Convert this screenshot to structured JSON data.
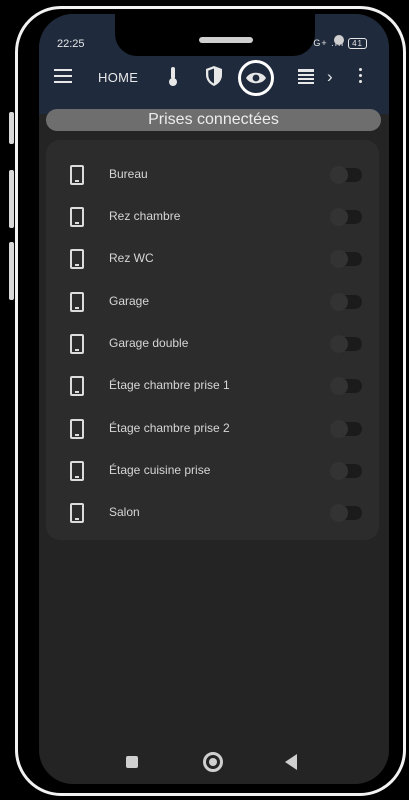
{
  "status": {
    "time": "22:25",
    "right": "4G+ .ıll",
    "battery": "41"
  },
  "appbar": {
    "home_label": "HOME",
    "tabs": [
      "menu-icon",
      "thermometer-icon",
      "shield-icon",
      "eye-icon",
      "list-icon",
      "chevron-right-icon",
      "more-vert-icon"
    ],
    "active_tab": "eye-icon",
    "chevron": "›"
  },
  "section": {
    "title": "Prises connectées"
  },
  "devices": [
    {
      "label": "Bureau",
      "on": false
    },
    {
      "label": "Rez chambre",
      "on": false
    },
    {
      "label": "Rez WC",
      "on": false
    },
    {
      "label": "Garage",
      "on": false
    },
    {
      "label": "Garage double",
      "on": false
    },
    {
      "label": "Étage chambre prise 1",
      "on": false
    },
    {
      "label": "Étage chambre prise 2",
      "on": false
    },
    {
      "label": "Étage cuisine prise",
      "on": false
    },
    {
      "label": "Salon",
      "on": false
    }
  ],
  "colors": {
    "appbar": "#1f2b3d",
    "screen": "#242424",
    "card": "#2c2c2c",
    "header": "#6e6e6e"
  }
}
